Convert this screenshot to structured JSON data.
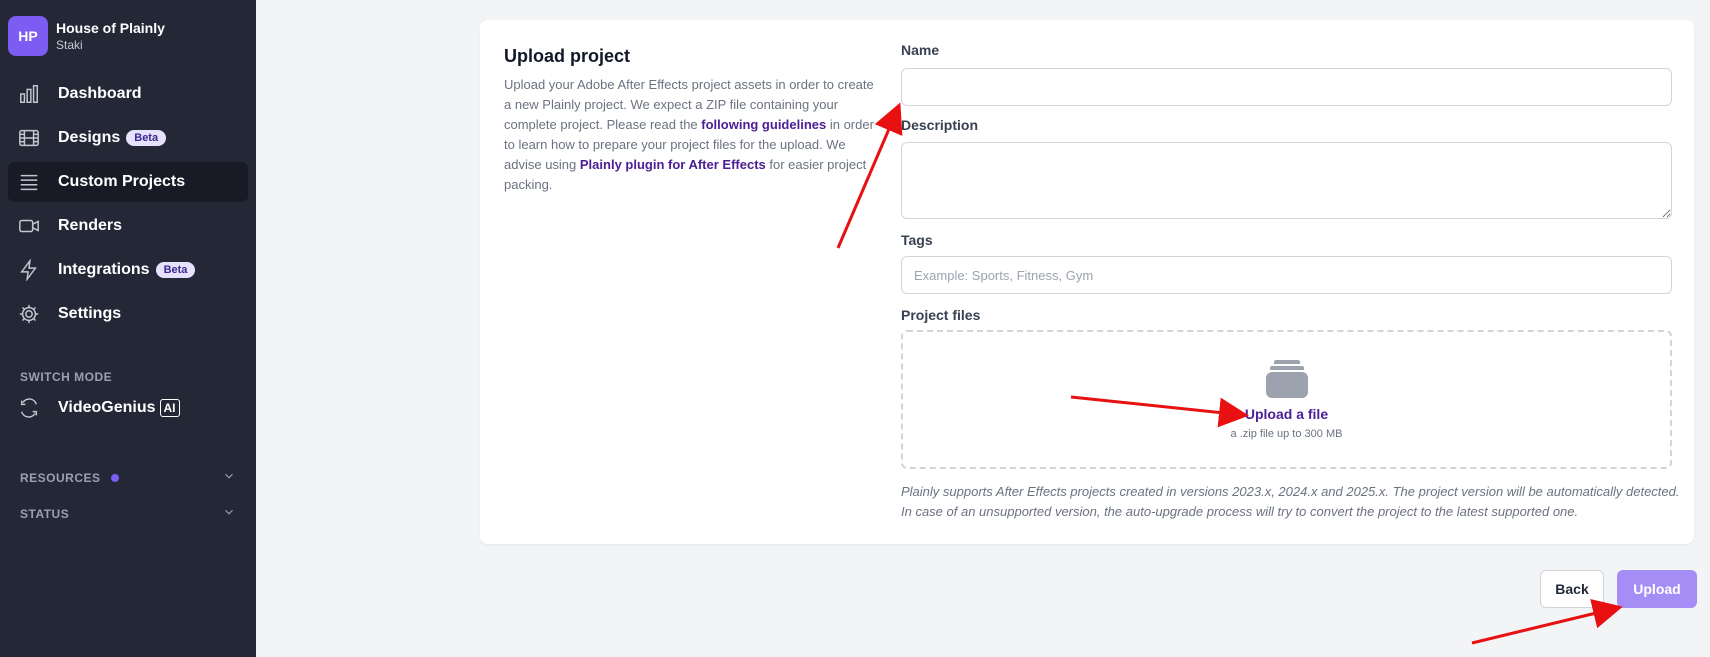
{
  "org": {
    "initials": "HP",
    "name": "House of Plainly",
    "subtitle": "Staki"
  },
  "nav": {
    "items": [
      {
        "label": "Dashboard",
        "icon": "bar-chart-icon"
      },
      {
        "label": "Designs",
        "icon": "film-icon",
        "badge": "Beta"
      },
      {
        "label": "Custom Projects",
        "icon": "list-icon",
        "active": true
      },
      {
        "label": "Renders",
        "icon": "video-camera-icon"
      },
      {
        "label": "Integrations",
        "icon": "lightning-icon",
        "badge": "Beta"
      },
      {
        "label": "Settings",
        "icon": "gear-icon"
      }
    ]
  },
  "switch_mode": {
    "label": "SWITCH MODE",
    "item_label": "VideoGenius",
    "ai_badge": "AI",
    "icon": "refresh-icon"
  },
  "resources": {
    "label": "RESOURCES"
  },
  "status": {
    "label": "STATUS"
  },
  "intro": {
    "title": "Upload project",
    "text_1": "Upload your Adobe After Effects project assets in order to create a new Plainly project. We expect a ZIP file containing your complete project. Please read the ",
    "link_1": "following guidelines",
    "text_2": " in order to learn how to prepare your project files for the upload. We advise using ",
    "link_2": "Plainly plugin for After Effects",
    "text_3": " for easier project packing."
  },
  "form": {
    "name_label": "Name",
    "name_value": "",
    "description_label": "Description",
    "description_value": "",
    "tags_label": "Tags",
    "tags_placeholder": "Example: Sports, Fitness, Gym",
    "files_label": "Project files",
    "upload_link": "Upload a file",
    "upload_hint": "a .zip file up to 300 MB",
    "note": "Plainly supports After Effects projects created in versions 2023.x, 2024.x and 2025.x. The project version will be automatically detected. In case of an unsupported version, the auto-upgrade process will try to convert the project to the latest supported one."
  },
  "actions": {
    "back_label": "Back",
    "upload_label": "Upload"
  },
  "colors": {
    "sidebar_bg": "#242836",
    "accent": "#7c5cf2",
    "link": "#4c1d95",
    "upload_button": "#a48df5",
    "annotation": "#e81010"
  }
}
